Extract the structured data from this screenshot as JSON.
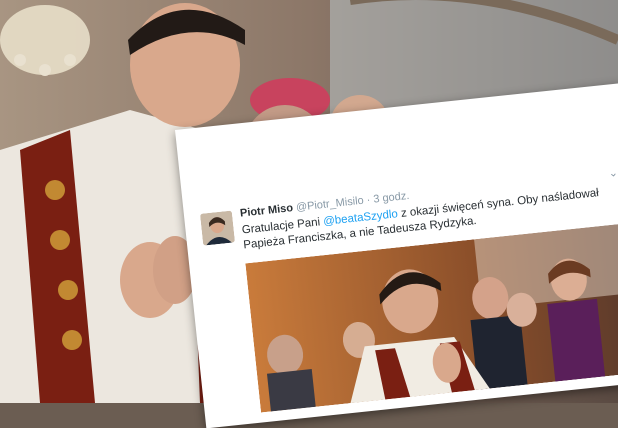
{
  "tweet": {
    "author_name": "Piotr Miso",
    "handle": "@Piotr_Misilo",
    "separator": "·",
    "time": "3 godz.",
    "chevron": "⌄",
    "text_before": "Gratulacje Pani ",
    "mention": "@beataSzydlo",
    "text_after": " z okazji święceń syna. Oby naśladował Papieża Franciszka, a nie Tadeusza Rydzyka."
  },
  "colors": {
    "mention": "#1da1f2",
    "meta": "#8899a6",
    "text": "#292f33"
  },
  "icons": {
    "menu": "chevron-down-icon"
  }
}
